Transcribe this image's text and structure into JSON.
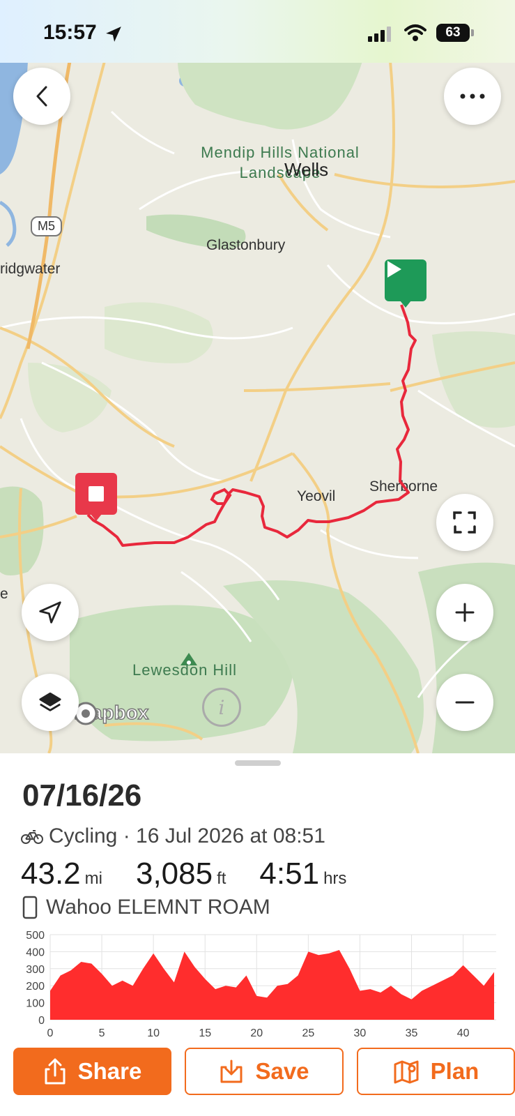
{
  "status": {
    "time": "15:57",
    "battery": "63"
  },
  "map": {
    "places": {
      "mendip": "Mendip Hills National Landscape",
      "wells": "Wells",
      "motorway": "M5",
      "glastonbury": "Glastonbury",
      "bridgwater": "ridgwater",
      "yeovil": "Yeovil",
      "sherborne": "Sherborne",
      "lewesdon": "Lewesdon Hill",
      "edge_e": "e"
    },
    "attribution": "mapbox",
    "colors": {
      "route": "#e8283c",
      "start": "#1e9a58",
      "end": "#e8384a"
    }
  },
  "activity": {
    "date": "07/16/26",
    "type_line": "Cycling · 16 Jul 2026 at 08:51",
    "distance": {
      "value": "43.2",
      "unit": "mi"
    },
    "elevation": {
      "value": "3,085",
      "unit": "ft"
    },
    "duration": {
      "value": "4:51",
      "unit": "hrs"
    },
    "device": "Wahoo ELEMNT ROAM"
  },
  "chart_data": {
    "type": "area",
    "x": [
      0,
      1,
      2,
      3,
      4,
      5,
      6,
      7,
      8,
      9,
      10,
      11,
      12,
      13,
      14,
      15,
      16,
      17,
      18,
      19,
      20,
      21,
      22,
      23,
      24,
      25,
      26,
      27,
      28,
      29,
      30,
      31,
      32,
      33,
      34,
      35,
      36,
      37,
      38,
      39,
      40,
      41,
      42,
      43
    ],
    "y": [
      170,
      260,
      290,
      340,
      330,
      270,
      200,
      230,
      200,
      300,
      390,
      300,
      220,
      400,
      310,
      240,
      180,
      200,
      190,
      260,
      140,
      130,
      200,
      210,
      260,
      400,
      380,
      390,
      410,
      300,
      170,
      180,
      160,
      200,
      150,
      120,
      170,
      200,
      230,
      260,
      320,
      260,
      200,
      280
    ],
    "xlim": [
      0,
      43.2
    ],
    "ylim": [
      0,
      500
    ],
    "xticks": [
      0,
      5,
      10,
      15,
      20,
      25,
      30,
      35,
      40
    ],
    "yticks": [
      0,
      100,
      200,
      300,
      400,
      500
    ],
    "color": "#ff2d2d",
    "grid": true
  },
  "buttons": {
    "share": "Share",
    "save": "Save",
    "plan": "Plan"
  }
}
